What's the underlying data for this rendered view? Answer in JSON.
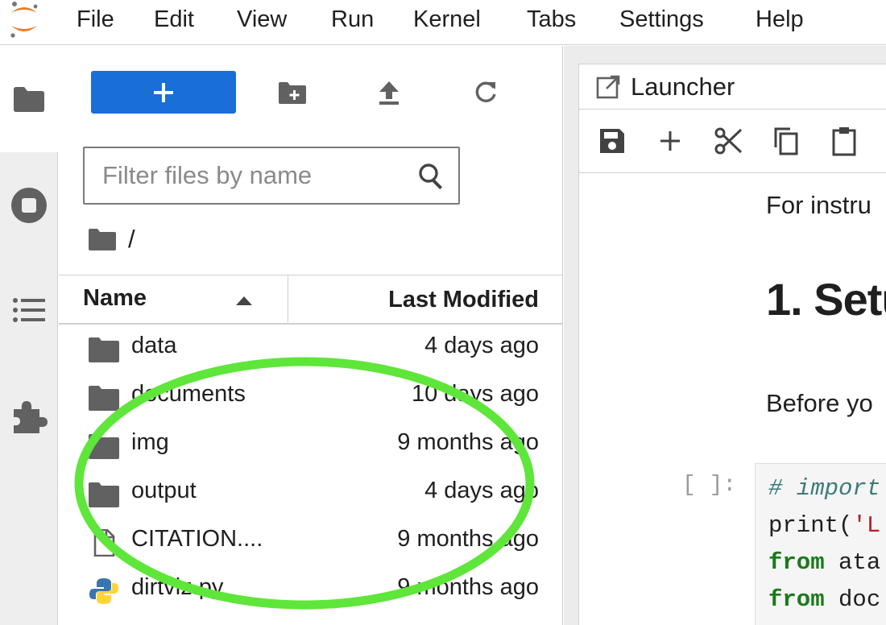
{
  "colors": {
    "accent": "#1a6ed8",
    "annotation": "#5ee63a",
    "code_keyword": "#1a7a1a",
    "code_comment": "#3d7a7a",
    "code_string": "#b22222"
  },
  "menubar": {
    "logo": "jupyter-logo-icon",
    "items": [
      "File",
      "Edit",
      "View",
      "Run",
      "Kernel",
      "Tabs",
      "Settings",
      "Help"
    ]
  },
  "activity_bar": {
    "items": [
      "folder-icon",
      "stop-circle-icon",
      "list-icon",
      "puzzle-icon"
    ]
  },
  "file_browser": {
    "toolbar": [
      "plus-icon",
      "new-folder-icon",
      "upload-icon",
      "refresh-icon"
    ],
    "filter_placeholder": "Filter files by name",
    "breadcrumb": "/",
    "columns": {
      "name": "Name",
      "modified": "Last Modified"
    },
    "files": [
      {
        "icon": "folder-icon",
        "name": "data",
        "modified": "4 days ago"
      },
      {
        "icon": "folder-icon",
        "name": "documents",
        "modified": "10 days ago"
      },
      {
        "icon": "folder-icon",
        "name": "img",
        "modified": "9 months ago"
      },
      {
        "icon": "folder-icon",
        "name": "output",
        "modified": "4 days ago"
      },
      {
        "icon": "file-icon",
        "name": "CITATION....",
        "modified": "9 months ago"
      },
      {
        "icon": "python-icon",
        "name": "dirtviz.py",
        "modified": "9 months ago"
      }
    ]
  },
  "workarea": {
    "tab_label": "Launcher",
    "notebook_toolbar": [
      "save-icon",
      "plus-icon",
      "cut-icon",
      "copy-icon",
      "paste-icon"
    ],
    "md_line_1": "For instru",
    "md_heading": "1. Setu",
    "md_line_2": "Before yo",
    "cell_prompt": "[ ]:",
    "code": {
      "line1": "# import",
      "line2_fn": "print(",
      "line2_str": "'L",
      "line3_kw": "from",
      "line3_rest": " ata",
      "line4_kw": "from",
      "line4_rest": " doc"
    }
  }
}
